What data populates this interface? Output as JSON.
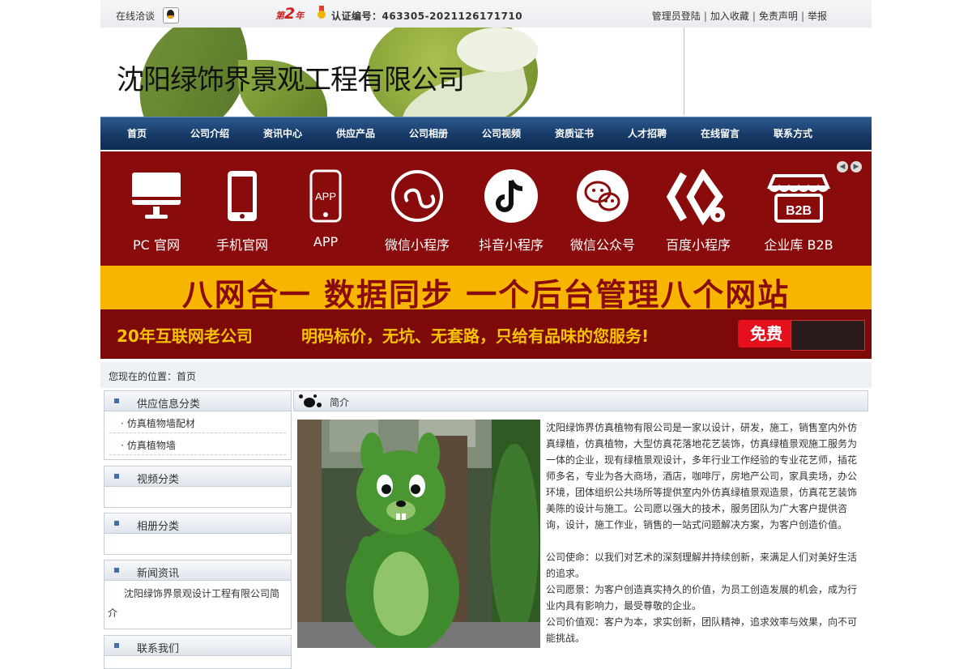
{
  "topbar": {
    "online": "在线洽谈",
    "year_prefix": "第",
    "year_num": "2",
    "year_suffix": "年",
    "cert": "认证编号：463305-2021126171710",
    "links": [
      "管理员登陆",
      "加入收藏",
      "免责声明",
      "举报"
    ],
    "sep": "|"
  },
  "header": {
    "company": "沈阳绿饰界景观工程有限公司"
  },
  "nav": [
    "首页",
    "公司介绍",
    "资讯中心",
    "供应产品",
    "公司相册",
    "公司视频",
    "资质证书",
    "人才招聘",
    "在线留言",
    "联系方式"
  ],
  "banner": {
    "icons": [
      {
        "label": "PC 官网",
        "icon": "monitor-icon"
      },
      {
        "label": "手机官网",
        "icon": "mobile-icon"
      },
      {
        "label": "APP",
        "icon": "app-icon"
      },
      {
        "label": "微信小程序",
        "icon": "mini-program-icon"
      },
      {
        "label": "抖音小程序",
        "icon": "douyin-icon"
      },
      {
        "label": "微信公众号",
        "icon": "wechat-icon"
      },
      {
        "label": "百度小程序",
        "icon": "baidu-icon"
      },
      {
        "label": "企业库 B2B",
        "icon": "b2b-store-icon"
      }
    ],
    "app_text": "APP",
    "b2b_text": "B2B",
    "slogan": "八网合一  数据同步  一个后台管理八个网站",
    "strip_left": "20年互联网老公司",
    "strip_right": "明码标价，无坑、无套路，只给有品味的您服务!",
    "free": "免费",
    "colors": {
      "banner_bg": "#8a0b0b",
      "band": "#f7b500",
      "accent": "#f6c300"
    }
  },
  "breadcrumb": "您现在的位置：首页",
  "sidebar": {
    "supply": {
      "title": "供应信息分类",
      "items": [
        "仿真植物墙配材",
        "仿真植物墙"
      ]
    },
    "video": {
      "title": "视频分类"
    },
    "album": {
      "title": "相册分类"
    },
    "news": {
      "title": "新闻资讯",
      "text": "沈阳绿饰界景观设计工程有限公司简介"
    },
    "contact": {
      "title": "联系我们"
    }
  },
  "main": {
    "title": "简介",
    "paragraphs": [
      "沈阳绿饰界仿真植物有限公司是一家以设计，研发，施工，销售室内外仿真绿植，仿真植物，大型仿真花落地花艺装饰，仿真绿植景观施工服务为一体的企业，现有绿植景观设计，多年行业工作经验的专业花艺师，插花师多名，专业为各大商场，酒店，咖啡厅，房地产公司，家具卖场，办公环境，团体组织公共场所等提供室内外仿真绿植景观造景，仿真花艺装饰美陈的设计与施工。公司愿以强大的技术，服务团队为广大客户提供咨询，设计，施工作业，销售的一站式问题解决方案，为客户创造价值。",
      "",
      "公司使命：以我们对艺术的深刻理解并持续创新，来满足人们对美好生活的追求。",
      "公司愿景：为客户创造真实持久的价值，为员工创造发展的机会，成为行业内具有影响力，最受尊敬的企业。",
      "公司价值观：客户为本，求实创新，团队精神，追求效率与效果，向不可能挑战。"
    ]
  }
}
